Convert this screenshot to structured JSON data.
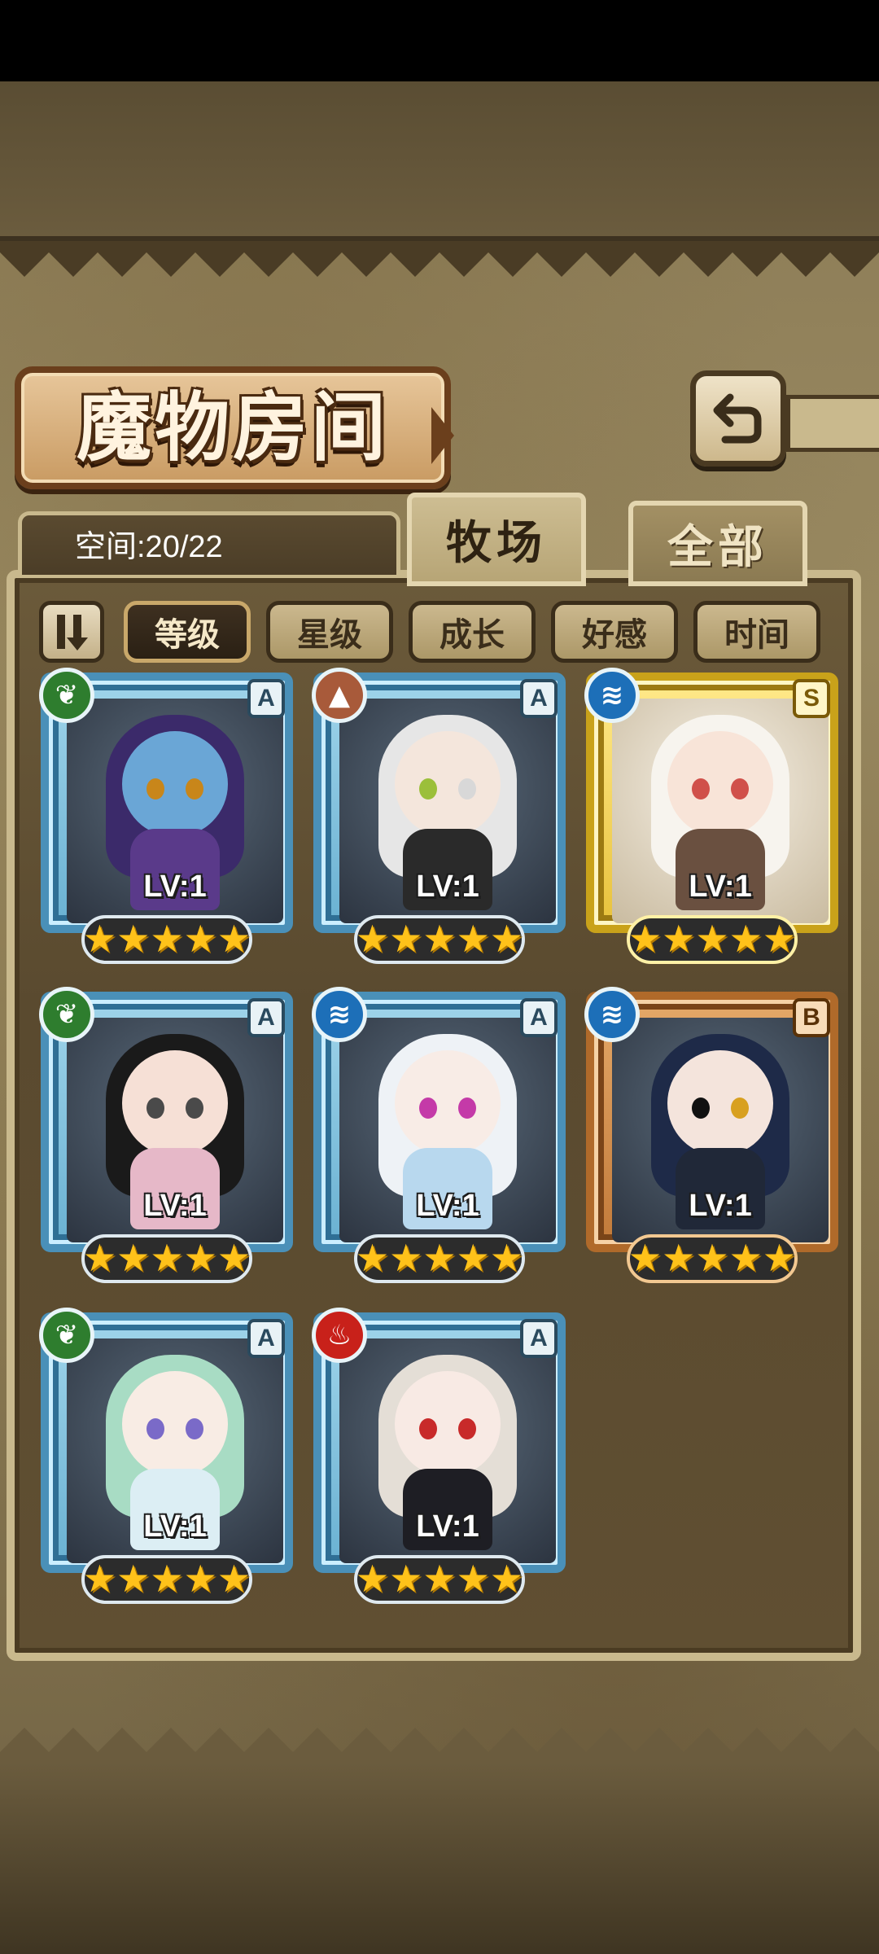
{
  "title": "魔物房间",
  "space": "空间:20/22",
  "tabs": {
    "ranch": "牧场",
    "all": "全部"
  },
  "sort": {
    "toggle_icon": "sort-order-icon",
    "options": [
      "等级",
      "星级",
      "成长",
      "好感",
      "时间"
    ],
    "active": "等级"
  },
  "monsters": [
    {
      "element": "grass",
      "element_icon": "leaf-icon",
      "grade": "A",
      "level": "LV:1",
      "stars": 5,
      "frame": "blue"
    },
    {
      "element": "earth",
      "element_icon": "mountain-icon",
      "grade": "A",
      "level": "LV:1",
      "stars": 5,
      "frame": "blue"
    },
    {
      "element": "water",
      "element_icon": "water-wave-icon",
      "grade": "S",
      "level": "LV:1",
      "stars": 5,
      "frame": "gold"
    },
    {
      "element": "grass",
      "element_icon": "leaf-icon",
      "grade": "A",
      "level": "LV:1",
      "stars": 5,
      "frame": "blue"
    },
    {
      "element": "water",
      "element_icon": "water-wave-icon",
      "grade": "A",
      "level": "LV:1",
      "stars": 5,
      "frame": "blue"
    },
    {
      "element": "water",
      "element_icon": "water-wave-icon",
      "grade": "B",
      "level": "LV:1",
      "stars": 5,
      "frame": "bronze"
    },
    {
      "element": "grass",
      "element_icon": "leaf-icon",
      "grade": "A",
      "level": "LV:1",
      "stars": 5,
      "frame": "blue"
    },
    {
      "element": "fire",
      "element_icon": "flame-icon",
      "grade": "A",
      "level": "LV:1",
      "stars": 5,
      "frame": "blue"
    }
  ],
  "colors": {
    "frame_blue": "#4a90b8",
    "frame_gold": "#c9a21a",
    "frame_bronze": "#b06a2a",
    "star": "#ffc21a"
  }
}
